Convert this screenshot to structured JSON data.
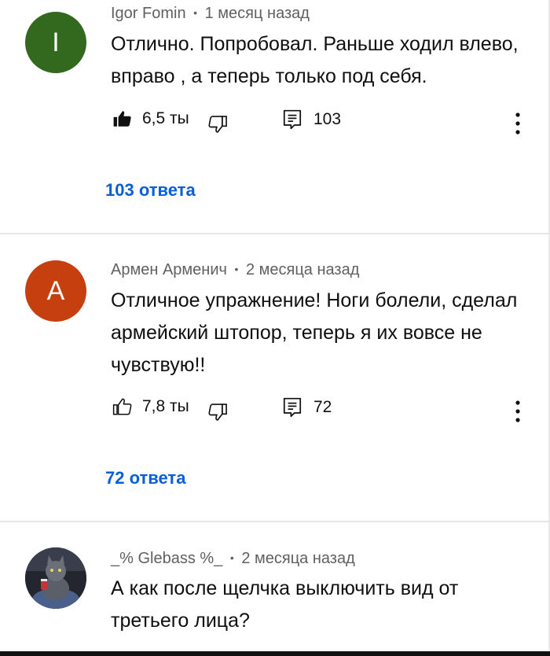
{
  "comments": [
    {
      "avatar_letter": "I",
      "avatar_color": "#33691e",
      "author": "Igor Fomin",
      "time": "1 месяц назад",
      "text": "Отлично. Попробовал. Раньше ходил влево, вправо , а теперь только под себя.",
      "likes": "6,5 ты",
      "liked": true,
      "reply_count": "103",
      "replies_label": "103 ответа"
    },
    {
      "avatar_letter": "A",
      "avatar_color": "#c6400f",
      "author": "Армен Арменич",
      "time": "2 месяца назад",
      "text": "Отличное упражнение! Ноги болели, сделал армейский штопор, теперь я их вовсе не чувствую!!",
      "likes": "7,8 ты",
      "liked": false,
      "reply_count": "72",
      "replies_label": "72 ответа"
    },
    {
      "avatar_letter": "",
      "avatar_color": "#2a2d3a",
      "author": "_% Glebass %_",
      "time": "2 месяца назад",
      "text": "А как после щелчка выключить вид от третьего лица?"
    }
  ],
  "separator": "•",
  "icons": {
    "like": "thumbs-up-icon",
    "dislike": "thumbs-down-icon",
    "reply": "reply-comment-icon",
    "menu": "more-vert-icon"
  }
}
